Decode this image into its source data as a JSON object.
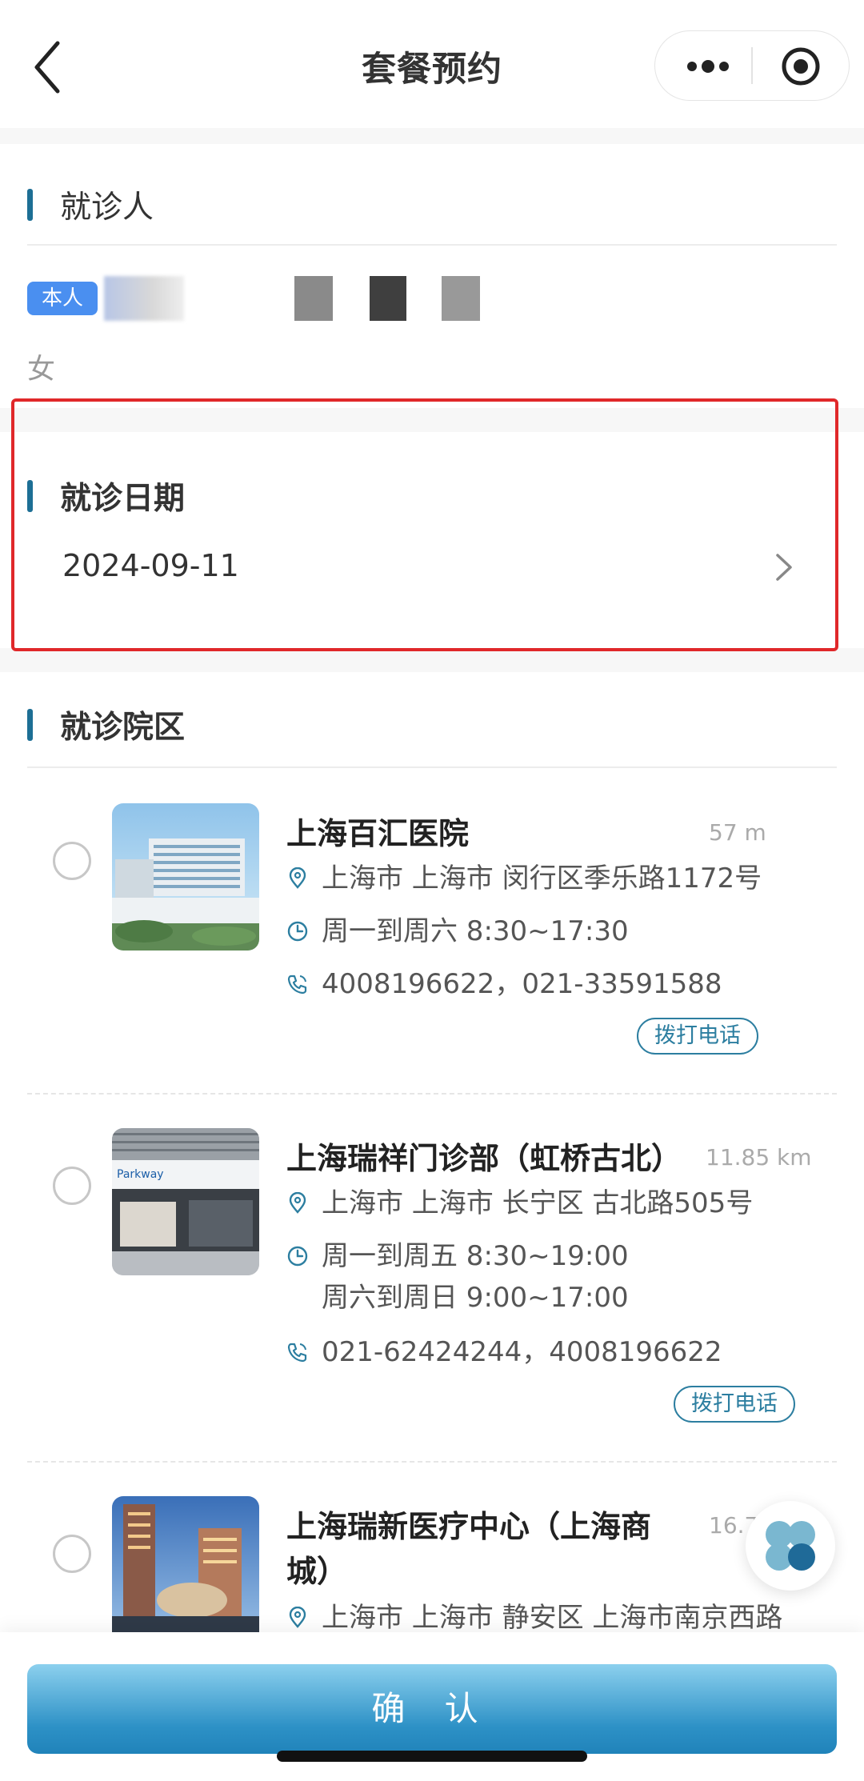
{
  "header": {
    "title": "套餐预约"
  },
  "patient_section": {
    "title": "就诊人",
    "tag": "本人",
    "gender": "女"
  },
  "date_section": {
    "title": "就诊日期",
    "date": "2024-09-11"
  },
  "campus_section": {
    "title": "就诊院区",
    "hospitals": [
      {
        "name": "上海百汇医院",
        "distance": "57 m",
        "address": "上海市 上海市 闵行区季乐路1172号",
        "hours": [
          "周一到周六 8:30~17:30"
        ],
        "phone": "4008196622，021-33591588",
        "call_label": "拨打电话"
      },
      {
        "name": "上海瑞祥门诊部（虹桥古北）",
        "distance": "11.85 km",
        "address": "上海市 上海市 长宁区 古北路505号",
        "hours": [
          "周一到周五 8:30~19:00",
          "周六到周日 9:00~17:00"
        ],
        "phone": "021-62424244，4008196622",
        "call_label": "拨打电话"
      },
      {
        "name_line1": "上海瑞新医疗中心（上海商",
        "name_line2": "城）",
        "distance": "16.7",
        "address": "上海市 上海市 静安区 上海市南京西路"
      }
    ]
  },
  "footer": {
    "confirm_label": "确 认"
  },
  "colors": {
    "accent": "#1d6f95",
    "highlight_border": "#e0282a",
    "tag_blue": "#4a8ff0"
  }
}
